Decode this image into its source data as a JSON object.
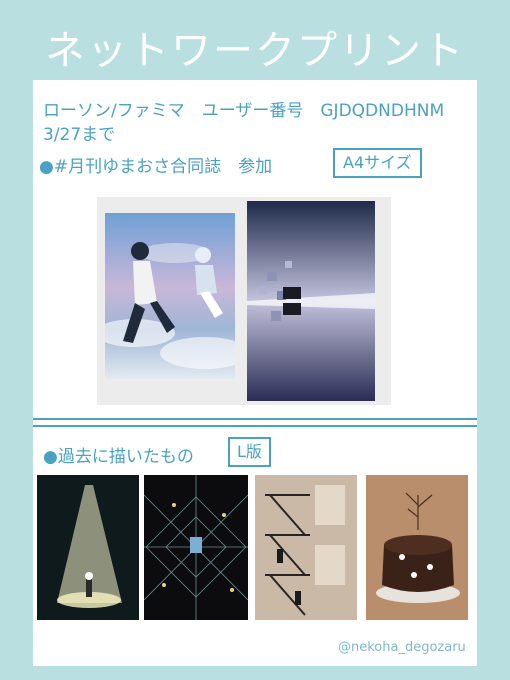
{
  "header": {
    "title": "ネットワークプリント"
  },
  "info": {
    "line1": "ローソン/ファミマ　ユーザー番号　GJDQDNDHNM",
    "line2": "3/27まで",
    "event": "●#月刊ゆまおさ合同誌　参加",
    "size_label": "A4サイズ"
  },
  "past": {
    "heading": "●過去に描いたもの",
    "size_label": "L版"
  },
  "footer": {
    "handle": "@nekoha_degozaru"
  }
}
